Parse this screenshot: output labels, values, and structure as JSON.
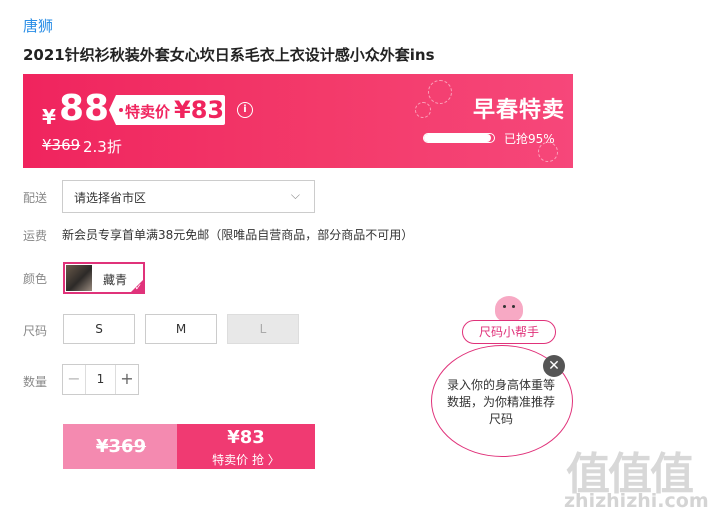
{
  "brand": "唐狮",
  "product_title": "2021针织衫秋装外套女心坎日系毛衣上衣设计感小众外套ins",
  "price_banner": {
    "currency": "¥",
    "price": "88",
    "sale_label": "特卖价",
    "sale_price": "¥83",
    "info_icon": "info-icon",
    "original_price": "¥369",
    "discount": "2.3折",
    "promo_title": "早春特卖",
    "sold_percent": 95,
    "sold_text": "已抢95%"
  },
  "delivery": {
    "label": "配送",
    "placeholder_value": "请选择省市区",
    "chevron_icon": "chevron-down-icon"
  },
  "shipping": {
    "label": "运费",
    "text": "新会员专享首单满38元免邮（限唯品自营商品，部分商品不可用）"
  },
  "color": {
    "label": "颜色",
    "options": [
      {
        "name": "藏青",
        "selected": true
      }
    ]
  },
  "size": {
    "label": "尺码",
    "options": [
      {
        "name": "S",
        "available": true
      },
      {
        "name": "M",
        "available": true
      },
      {
        "name": "L",
        "available": false
      }
    ]
  },
  "quantity": {
    "label": "数量",
    "minus": "−",
    "value": "1",
    "plus": "+"
  },
  "buy_button": {
    "original_price": "¥369",
    "sale_price": "¥83",
    "action": "特卖价 抢 〉"
  },
  "size_helper": {
    "tag": "尺码小帮手",
    "text": "录入你的身高体重等数据，为你精准推荐尺码",
    "close_icon": "close-icon"
  },
  "watermark": {
    "logo": "值值值",
    "url": "zhizhizhi.com"
  },
  "colors": {
    "accent": "#f0245e",
    "link": "#2a8ee6",
    "border_pink": "#e0327a"
  }
}
